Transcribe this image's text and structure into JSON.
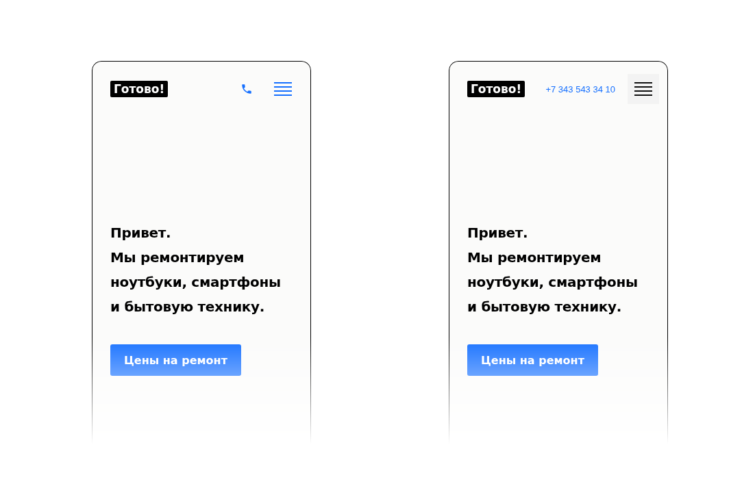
{
  "mockups": [
    {
      "logo": "Готово!",
      "contact": {
        "kind": "icon"
      },
      "menu": {
        "highlighted": false
      },
      "headline": "Привет.\nМы ремонтируем\nноутбуки, смартфоны\nи бытовую технику.",
      "button": "Цены на ремонт"
    },
    {
      "logo": "Готово!",
      "contact": {
        "kind": "number",
        "text": "+7 343 543 34 10"
      },
      "menu": {
        "highlighted": true
      },
      "headline": "Привет.\nМы ремонтируем\nноутбуки, смартфоны\nи бытовую технику.",
      "button": "Цены на ремонт"
    }
  ]
}
